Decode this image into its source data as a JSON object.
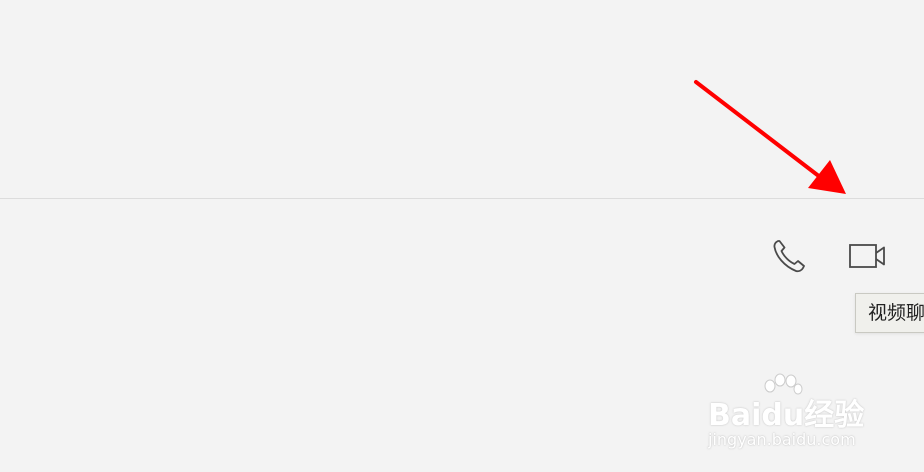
{
  "toolbar": {
    "phone_icon": "phone-icon",
    "video_icon": "video-camera-icon",
    "tooltip_text": "视频聊"
  },
  "annotation": {
    "arrow_color": "#ff0000"
  },
  "watermark": {
    "main_text": "Baidu经验",
    "sub_text": "jingyan.baidu.com"
  }
}
